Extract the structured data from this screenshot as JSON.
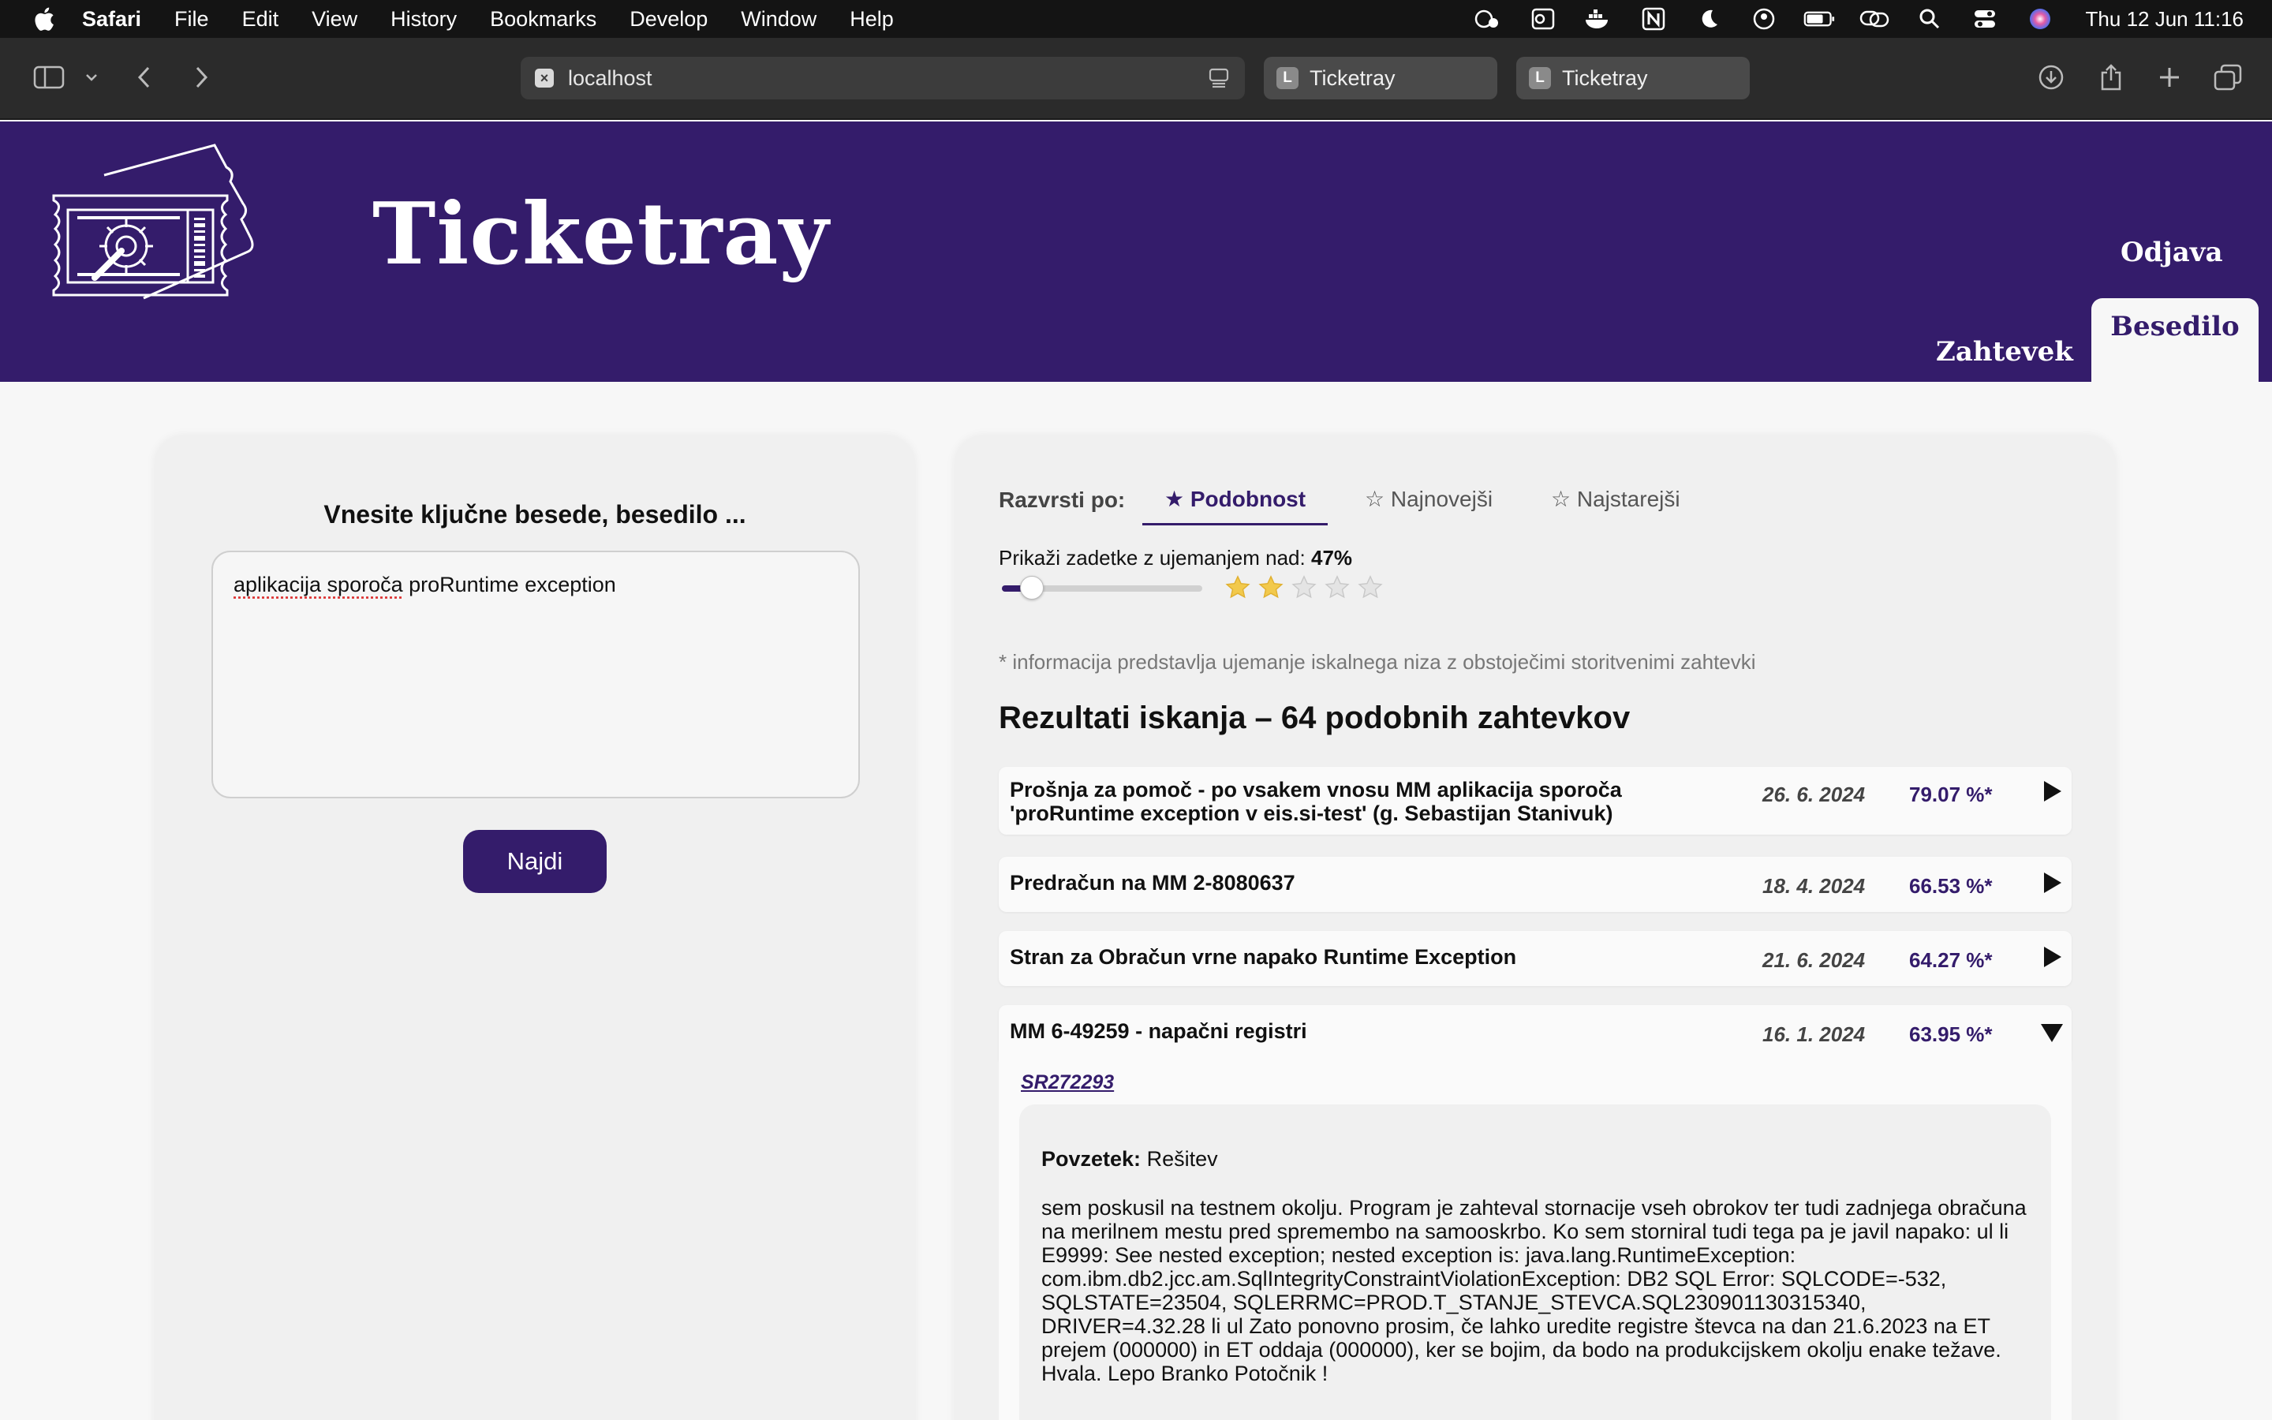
{
  "menubar": {
    "app_name": "Safari",
    "items": [
      "File",
      "Edit",
      "View",
      "History",
      "Bookmarks",
      "Develop",
      "Window",
      "Help"
    ],
    "clock": "Thu 12 Jun  11:16"
  },
  "browser": {
    "address": "localhost",
    "tabs": [
      {
        "favicon": "L",
        "label": "Ticketray"
      },
      {
        "favicon": "L",
        "label": "Ticketray"
      }
    ]
  },
  "header": {
    "title": "Ticketray",
    "logout": "Odjava",
    "nav": {
      "zahtevek": "Zahtevek",
      "besedilo": "Besedilo"
    },
    "colors": {
      "primary": "#341c6b"
    }
  },
  "search": {
    "heading": "Vnesite ključne besede, besedilo ...",
    "query_underlined": "aplikacija sporoča",
    "query_rest": " proRuntime exception",
    "button": "Najdi"
  },
  "results_panel": {
    "sort_label": "Razvrsti po:",
    "sort_options": [
      "★ Podobnost",
      "☆ Najnovejši",
      "☆ Najstarejši"
    ],
    "active_sort": 0,
    "threshold_label": "Prikaži zadetke z ujemanjem nad:",
    "threshold_value": "47%",
    "threshold_fraction": 0.15,
    "stars_filled": 2,
    "stars_total": 5,
    "note": "* informacija predstavlja ujemanje iskalnega niza z obstoječimi storitvenimi zahtevki",
    "results_title": "Rezultati iskanja – 64 podobnih zahtevkov",
    "results": [
      {
        "title": "Prošnja za pomoč - po vsakem vnosu MM aplikacija sporoča 'proRuntime exception v eis.si-test' (g. Sebastijan Stanivuk)",
        "date": "26. 6. 2024",
        "score": "79.07 %*",
        "expanded": false
      },
      {
        "title": "Predračun na MM 2-8080637",
        "date": "18. 4. 2024",
        "score": "66.53 %*",
        "expanded": false
      },
      {
        "title": "Stran za Obračun vrne napako Runtime Exception",
        "date": "21. 6. 2024",
        "score": "64.27 %*",
        "expanded": false
      },
      {
        "title": "MM 6-49259 - napačni registri",
        "date": "16. 1. 2024",
        "score": "63.95 %*",
        "expanded": true
      }
    ],
    "detail": {
      "sr": "SR272293",
      "summary_label": "Povzetek:",
      "summary_value": "Rešitev",
      "body": "sem poskusil na testnem okolju. Program je zahteval stornacije vseh obrokov ter tudi zadnjega obračuna na merilnem mestu pred spremembo na samooskrbo. Ko sem storniral tudi tega pa je javil napako: ul li E9999: See nested exception; nested exception is: java.lang.RuntimeException: com.ibm.db2.jcc.am.SqlIntegrityConstraintViolationException: DB2 SQL Error: SQLCODE=-532, SQLSTATE=23504, SQLERRMC=PROD.T_STANJE_STEVCA.SQL230901130315340, DRIVER=4.32.28 li ul Zato ponovno prosim, če lahko uredite registre števca na dan 21.6.2023 na ET prejem (000000) in ET oddaja (000000), ker se bojim, da bodo na produkcijskem okolju enake težave. Hvala. Lepo Branko Potočnik !"
    }
  }
}
